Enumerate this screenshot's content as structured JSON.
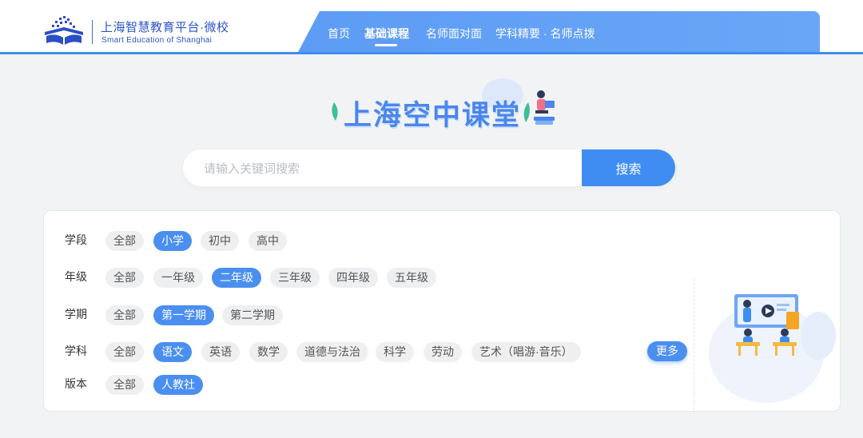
{
  "header": {
    "brand_cn": "上海智慧教育平台·微校",
    "brand_en": "Smart Education of Shanghai",
    "logo_icon": "book-logo-icon",
    "nav": [
      {
        "label": "首页",
        "active": false
      },
      {
        "label": "基础课程",
        "active": true
      },
      {
        "label": "名师面对面",
        "active": false
      },
      {
        "label": "学科精要 · 名师点拨",
        "active": false
      }
    ]
  },
  "hero": {
    "title": "上海空中课堂",
    "decoration_icon": "student-reading-icon"
  },
  "search": {
    "placeholder": "请输入关键词搜索",
    "value": "",
    "button_label": "搜索"
  },
  "filters": [
    {
      "label": "学段",
      "options": [
        "全部",
        "小学",
        "初中",
        "高中"
      ],
      "selected": "小学"
    },
    {
      "label": "年级",
      "options": [
        "全部",
        "一年级",
        "二年级",
        "三年级",
        "四年级",
        "五年级"
      ],
      "selected": "二年级"
    },
    {
      "label": "学期",
      "options": [
        "全部",
        "第一学期",
        "第二学期"
      ],
      "selected": "第一学期"
    },
    {
      "label": "学科",
      "options": [
        "全部",
        "语文",
        "英语",
        "数学",
        "道德与法治",
        "科学",
        "劳动",
        "艺术（唱游·音乐）"
      ],
      "selected": "语文"
    },
    {
      "label": "版本",
      "options": [
        "全部",
        "人教社"
      ],
      "selected": "人教社"
    }
  ],
  "more_label": "更多",
  "illustration_icon": "classroom-illustration-icon",
  "colors": {
    "accent": "#3f8df2",
    "chip_active": "#4a8ff0",
    "chip_inactive": "#eeeff1",
    "brand_text": "#2b56c8"
  }
}
